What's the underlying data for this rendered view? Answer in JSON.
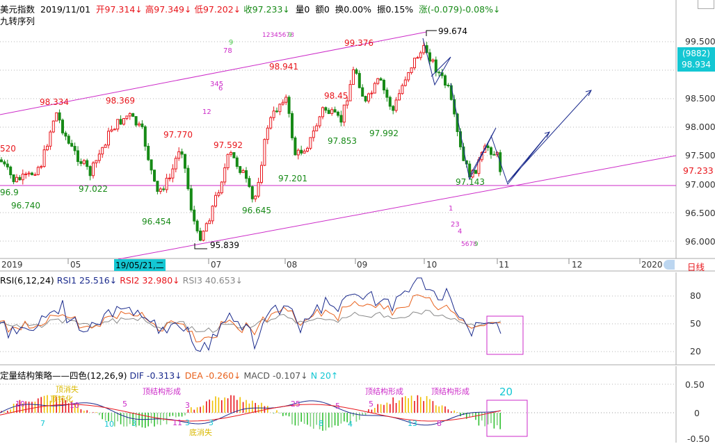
{
  "header": {
    "symbol": "美元指数",
    "date": "2019/11/01",
    "open": "开97.314↓",
    "high": "高97.349↓",
    "low": "低97.202↓",
    "close": "收97.233↓",
    "volume": "量0",
    "amount": "额0",
    "turnover": "换0.00%",
    "amplitude": "振0.15%",
    "change": "涨(-0.079)-0.08%↓"
  },
  "indicator_title": "九转序列",
  "price_axis": [
    "99.500",
    "99.000",
    "98.500",
    "98.000",
    "97.500",
    "97.000",
    "96.500",
    "96.000"
  ],
  "price_box": {
    "code": "(9882)",
    "value": "98.934"
  },
  "current_price": "97.233",
  "price_labels": [
    {
      "t": "99.674",
      "c": "black"
    },
    {
      "t": "99.376",
      "c": "red"
    },
    {
      "t": "98.941",
      "c": "red"
    },
    {
      "t": "98.334",
      "c": "red"
    },
    {
      "t": "98.369",
      "c": "red"
    },
    {
      "t": "98.45",
      "c": "red"
    },
    {
      "t": "97.770",
      "c": "red"
    },
    {
      "t": "97.592",
      "c": "red"
    },
    {
      "t": "520",
      "c": "red"
    },
    {
      "t": "97.853",
      "c": "green"
    },
    {
      "t": "97.992",
      "c": "green"
    },
    {
      "t": "97.201",
      "c": "green"
    },
    {
      "t": "97.143",
      "c": "green"
    },
    {
      "t": "97.022",
      "c": "green"
    },
    {
      "t": "96.740",
      "c": "green"
    },
    {
      "t": "96.9",
      "c": "green"
    },
    {
      "t": "96.454",
      "c": "green"
    },
    {
      "t": "96.645",
      "c": "green"
    },
    {
      "t": "95.839",
      "c": "black"
    }
  ],
  "nine_marks": [
    "9",
    "78",
    "1234​5678",
    "9",
    "345",
    "6",
    "12",
    "1",
    "23",
    "4",
    "5678",
    "9"
  ],
  "date_axis": [
    "2019",
    "05",
    "07",
    "08",
    "09",
    "10",
    "11",
    "12",
    "2020"
  ],
  "date_highlight": "19/05/21,二",
  "period_button": "日线",
  "rsi": {
    "title": "RSI(6,12,24)",
    "rsi1": "RSI1 25.516↓",
    "rsi2": "RSI2 32.980↓",
    "rsi3": "RSI3 40.653↓",
    "axis": [
      "80",
      "50",
      "20"
    ]
  },
  "macd": {
    "title": "定量结构策略——四色(12,26,9)",
    "dif": "DIF -0.313↓",
    "dea": "DEA -0.260↓",
    "macd": "MACD -0.107↓",
    "n": "N 20↑",
    "axis": [
      "0.50",
      "0",
      "-0.50"
    ],
    "box_value": "20",
    "annotations": [
      "顶消失",
      "顶钝化",
      "顶结构形成",
      "底消失",
      "顶结构形成",
      "顶结构形成"
    ],
    "counts": [
      "10",
      "10",
      "5",
      "3",
      "11",
      "3",
      "25",
      "5",
      "5",
      "8",
      "7",
      "10",
      "3",
      "3",
      "8",
      "4",
      "13"
    ]
  },
  "colors": {
    "up": "#e8151b",
    "down": "#178a17",
    "accent": "#14c7d3",
    "magenta": "#cc2ac8",
    "nav": "#1a2a8c"
  }
}
